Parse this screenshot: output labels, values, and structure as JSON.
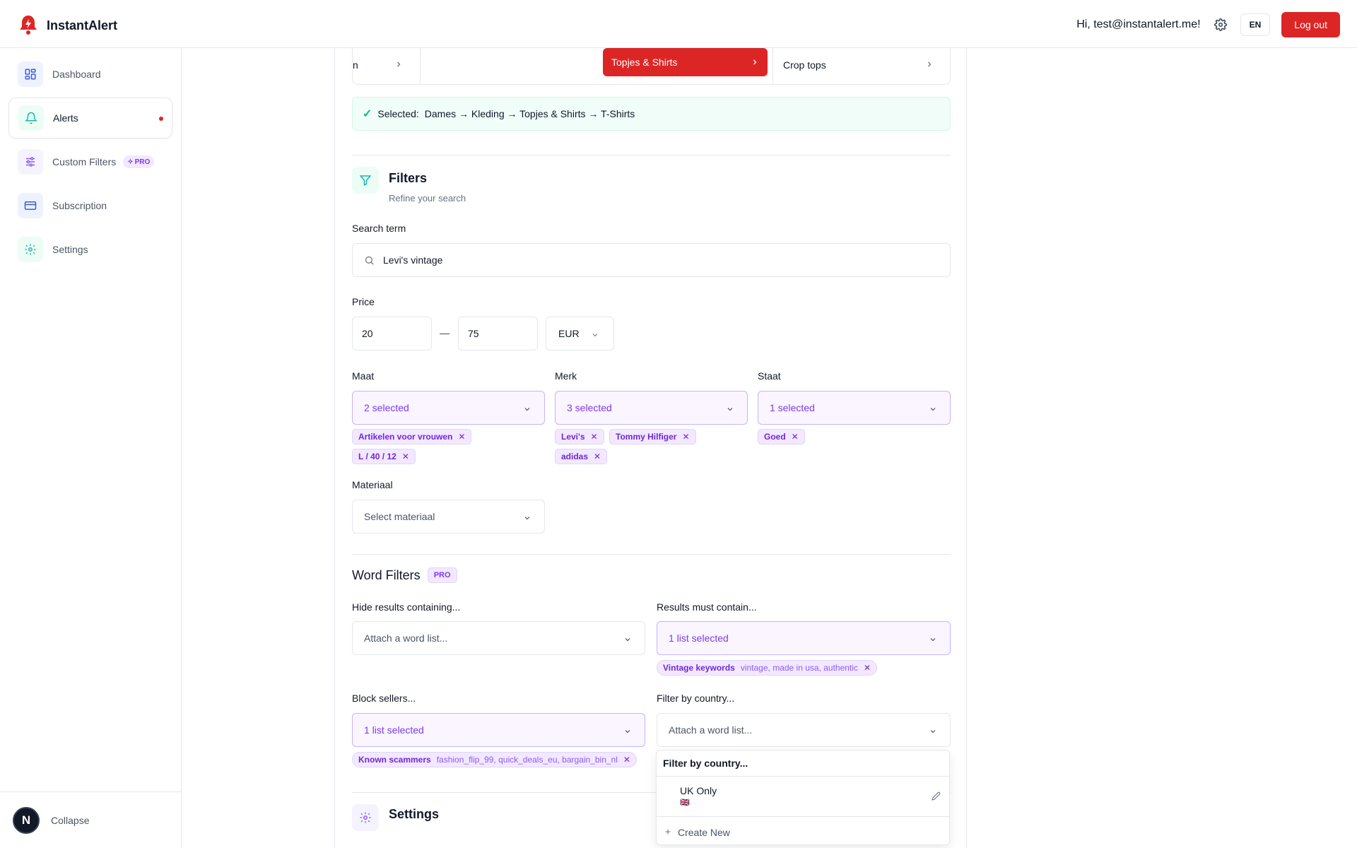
{
  "app": {
    "name": "InstantAlert"
  },
  "header": {
    "greeting": "Hi, test@instantalert.me!",
    "lang": "EN",
    "logout_label": "Log out"
  },
  "sidebar": {
    "items": [
      {
        "label": "Dashboard",
        "icon": "dashboard-icon"
      },
      {
        "label": "Alerts",
        "icon": "bell-icon"
      },
      {
        "label": "Custom Filters",
        "icon": "sliders-icon",
        "badge": "PRO"
      },
      {
        "label": "Subscription",
        "icon": "credit-card-icon"
      },
      {
        "label": "Settings",
        "icon": "gear-icon"
      }
    ],
    "avatar_letter": "N",
    "collapse_label": "Collapse"
  },
  "category": {
    "col1_tail": "n",
    "selected_item": "Topjes & Shirts",
    "next_item": "Crop tops",
    "selected_prefix": "Selected:",
    "selected_path": "Dames → Kleding → Topjes & Shirts → T-Shirts"
  },
  "filters": {
    "title": "Filters",
    "subtitle": "Refine your search",
    "search_label": "Search term",
    "search_value": "Levi's vintage",
    "price_label": "Price",
    "price_min": "20",
    "price_sep": "—",
    "price_max": "75",
    "currency": "EUR",
    "maat_label": "Maat",
    "maat_value": "2 selected",
    "maat_tags": [
      "Artikelen voor vrouwen",
      "L / 40 / 12"
    ],
    "merk_label": "Merk",
    "merk_value": "3 selected",
    "merk_tags": [
      "Levi's",
      "Tommy Hilfiger",
      "adidas"
    ],
    "staat_label": "Staat",
    "staat_value": "1 selected",
    "staat_tags": [
      "Goed"
    ],
    "materiaal_label": "Materiaal",
    "materiaal_placeholder": "Select materiaal"
  },
  "word_filters": {
    "title": "Word Filters",
    "badge": "PRO",
    "hide_label": "Hide results containing...",
    "hide_placeholder": "Attach a word list...",
    "must_label": "Results must contain...",
    "must_value": "1 list selected",
    "must_tag_name": "Vintage keywords",
    "must_tag_desc": "vintage, made in usa, authentic",
    "block_label": "Block sellers...",
    "block_value": "1 list selected",
    "block_tag_name": "Known scammers",
    "block_tag_desc": "fashion_flip_99, quick_deals_eu, bargain_bin_nl",
    "country_label": "Filter by country...",
    "country_placeholder": "Attach a word list..."
  },
  "popover": {
    "heading": "Filter by country...",
    "item": "UK Only",
    "item_flag": "🇬🇧",
    "create_label": "Create New"
  },
  "settings_section": {
    "title": "Settings"
  },
  "colors": {
    "accent": "#dc2626",
    "purple": "#7c3aed",
    "teal": "#10b981"
  }
}
